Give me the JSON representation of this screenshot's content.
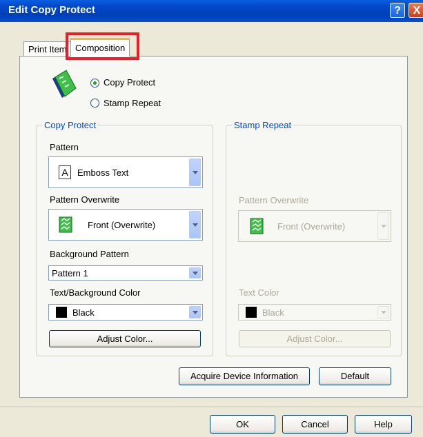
{
  "window": {
    "title": "Edit Copy Protect",
    "help_glyph": "?",
    "close_glyph": "X"
  },
  "tabs": {
    "print_item": "Print Item",
    "composition": "Composition"
  },
  "mode": {
    "copy_protect": "Copy Protect",
    "stamp_repeat": "Stamp Repeat",
    "selected": "copy_protect"
  },
  "copy_protect": {
    "group_title": "Copy Protect",
    "pattern_label": "Pattern",
    "pattern_value": "Emboss Text",
    "pattern_icon_glyph": "A",
    "overwrite_label": "Pattern Overwrite",
    "overwrite_value": "Front (Overwrite)",
    "bg_pattern_label": "Background Pattern",
    "bg_pattern_value": "Pattern 1",
    "color_label": "Text/Background Color",
    "color_value": "Black",
    "adjust_button": "Adjust Color..."
  },
  "stamp_repeat": {
    "group_title": "Stamp Repeat",
    "overwrite_label": "Pattern Overwrite",
    "overwrite_value": "Front (Overwrite)",
    "color_label": "Text Color",
    "color_value": "Black",
    "adjust_button": "Adjust Color..."
  },
  "buttons": {
    "acquire": "Acquire Device Information",
    "default": "Default",
    "ok": "OK",
    "cancel": "Cancel",
    "help": "Help"
  },
  "colors": {
    "title_bar": "#0346c8",
    "accent_highlight": "#ee1c25",
    "group_title": "#0046d5",
    "dialog_bg": "#ece9d8"
  }
}
